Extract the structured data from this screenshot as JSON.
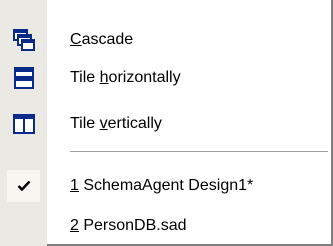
{
  "menu": {
    "items": [
      {
        "pre": "",
        "ul": "C",
        "post": "ascade",
        "icon": "cascade-windows-icon",
        "checked": false
      },
      {
        "pre": "Tile ",
        "ul": "h",
        "post": "orizontally",
        "icon": "tile-horizontally-icon",
        "checked": false
      },
      {
        "pre": "Tile ",
        "ul": "v",
        "post": "ertically",
        "icon": "tile-vertically-icon",
        "checked": false
      },
      {
        "pre": "",
        "ul": "1",
        "post": " SchemaAgent Design1*",
        "icon": "checkmark-icon",
        "checked": true
      },
      {
        "pre": "",
        "ul": "2",
        "post": " PersonDB.sad",
        "icon": "",
        "checked": false
      }
    ]
  },
  "colors": {
    "icon_blue": "#0a2a8a",
    "icon_fill": "#3f6fd8",
    "gutter": "#ebe9e3"
  }
}
